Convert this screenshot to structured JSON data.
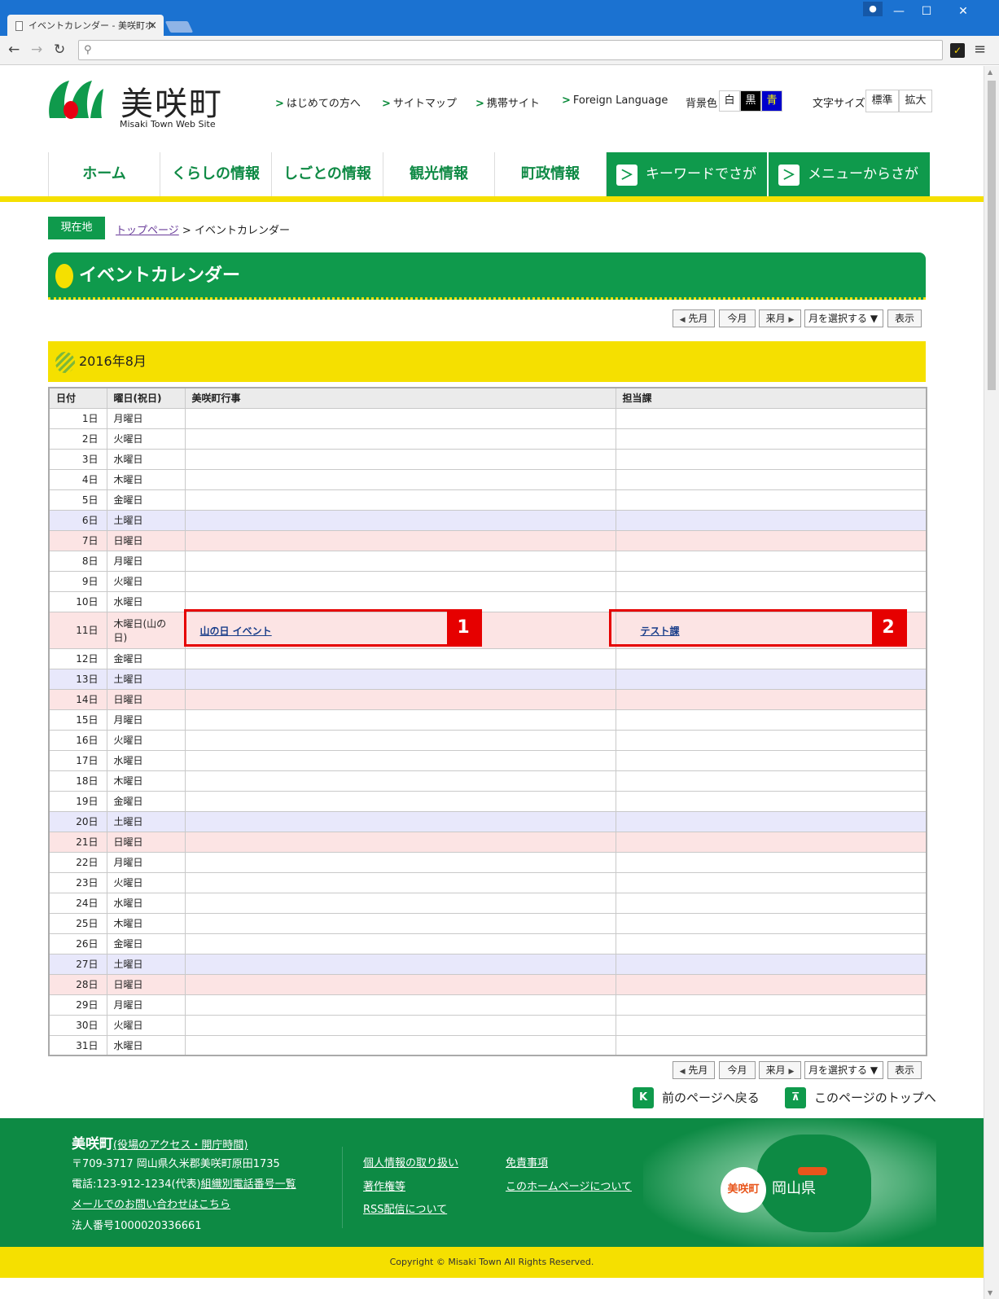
{
  "browser": {
    "tab_title": "イベントカレンダー - 美咲町ホ",
    "close": "×",
    "window_controls": {
      "min": "—",
      "max": "☐",
      "close": "✕"
    }
  },
  "header": {
    "site_name": "美咲町",
    "site_sub": "Misaki Town Web Site",
    "top_links": [
      "はじめての方へ",
      "サイトマップ",
      "携帯サイト",
      "Foreign Language"
    ],
    "bg_label": "背景色",
    "bg_options": [
      {
        "label": "白",
        "bg": "#ffffff",
        "fg": "#222222"
      },
      {
        "label": "黒",
        "bg": "#000000",
        "fg": "#ffffff"
      },
      {
        "label": "青",
        "bg": "#0000cc",
        "fg": "#ffff00"
      }
    ],
    "font_size_label": "文字サイズ",
    "font_size_options": [
      "標準",
      "拡大"
    ]
  },
  "global_nav": {
    "items": [
      "ホーム",
      "くらしの情報",
      "しごとの情報",
      "観光情報",
      "町政情報"
    ],
    "search_keyword": "キーワードでさがす",
    "search_menu": "メニューからさがす",
    "chevron": "＞"
  },
  "breadcrumb": {
    "here": "現在地",
    "top": "トップページ",
    "sep": ">",
    "current": "イベントカレンダー"
  },
  "page_title": "イベントカレンダー",
  "month_nav": {
    "prev": "先月",
    "now": "今月",
    "next": "来月",
    "select": "月を選択する",
    "show": "表示",
    "caret": "▼",
    "tri_left": "◀",
    "tri_right": "▶"
  },
  "month_heading": "2016年8月",
  "calendar": {
    "headers": [
      "日付",
      "曜日(祝日)",
      "美咲町行事",
      "担当課"
    ],
    "rows": [
      {
        "day": "1日",
        "weekday": "月曜日",
        "type": "weekday",
        "event": "",
        "dept": ""
      },
      {
        "day": "2日",
        "weekday": "火曜日",
        "type": "weekday",
        "event": "",
        "dept": ""
      },
      {
        "day": "3日",
        "weekday": "水曜日",
        "type": "weekday",
        "event": "",
        "dept": ""
      },
      {
        "day": "4日",
        "weekday": "木曜日",
        "type": "weekday",
        "event": "",
        "dept": ""
      },
      {
        "day": "5日",
        "weekday": "金曜日",
        "type": "weekday",
        "event": "",
        "dept": ""
      },
      {
        "day": "6日",
        "weekday": "土曜日",
        "type": "sat",
        "event": "",
        "dept": ""
      },
      {
        "day": "7日",
        "weekday": "日曜日",
        "type": "sun",
        "event": "",
        "dept": ""
      },
      {
        "day": "8日",
        "weekday": "月曜日",
        "type": "weekday",
        "event": "",
        "dept": ""
      },
      {
        "day": "9日",
        "weekday": "火曜日",
        "type": "weekday",
        "event": "",
        "dept": ""
      },
      {
        "day": "10日",
        "weekday": "水曜日",
        "type": "weekday",
        "event": "",
        "dept": ""
      },
      {
        "day": "11日",
        "weekday": "木曜日(山の日)",
        "type": "hol",
        "event": "山の日 イベント",
        "dept": "テスト課"
      },
      {
        "day": "12日",
        "weekday": "金曜日",
        "type": "weekday",
        "event": "",
        "dept": ""
      },
      {
        "day": "13日",
        "weekday": "土曜日",
        "type": "sat",
        "event": "",
        "dept": ""
      },
      {
        "day": "14日",
        "weekday": "日曜日",
        "type": "sun",
        "event": "",
        "dept": ""
      },
      {
        "day": "15日",
        "weekday": "月曜日",
        "type": "weekday",
        "event": "",
        "dept": ""
      },
      {
        "day": "16日",
        "weekday": "火曜日",
        "type": "weekday",
        "event": "",
        "dept": ""
      },
      {
        "day": "17日",
        "weekday": "水曜日",
        "type": "weekday",
        "event": "",
        "dept": ""
      },
      {
        "day": "18日",
        "weekday": "木曜日",
        "type": "weekday",
        "event": "",
        "dept": ""
      },
      {
        "day": "19日",
        "weekday": "金曜日",
        "type": "weekday",
        "event": "",
        "dept": ""
      },
      {
        "day": "20日",
        "weekday": "土曜日",
        "type": "sat",
        "event": "",
        "dept": ""
      },
      {
        "day": "21日",
        "weekday": "日曜日",
        "type": "sun",
        "event": "",
        "dept": ""
      },
      {
        "day": "22日",
        "weekday": "月曜日",
        "type": "weekday",
        "event": "",
        "dept": ""
      },
      {
        "day": "23日",
        "weekday": "火曜日",
        "type": "weekday",
        "event": "",
        "dept": ""
      },
      {
        "day": "24日",
        "weekday": "水曜日",
        "type": "weekday",
        "event": "",
        "dept": ""
      },
      {
        "day": "25日",
        "weekday": "木曜日",
        "type": "weekday",
        "event": "",
        "dept": ""
      },
      {
        "day": "26日",
        "weekday": "金曜日",
        "type": "weekday",
        "event": "",
        "dept": ""
      },
      {
        "day": "27日",
        "weekday": "土曜日",
        "type": "sat",
        "event": "",
        "dept": ""
      },
      {
        "day": "28日",
        "weekday": "日曜日",
        "type": "sun",
        "event": "",
        "dept": ""
      },
      {
        "day": "29日",
        "weekday": "月曜日",
        "type": "weekday",
        "event": "",
        "dept": ""
      },
      {
        "day": "30日",
        "weekday": "火曜日",
        "type": "weekday",
        "event": "",
        "dept": ""
      },
      {
        "day": "31日",
        "weekday": "水曜日",
        "type": "weekday",
        "event": "",
        "dept": ""
      }
    ]
  },
  "annotations": [
    "1",
    "2"
  ],
  "page_nav": {
    "back": "前のページへ戻る",
    "top": "このページのトップへ",
    "back_icon": "K",
    "top_icon": "⊼"
  },
  "footer": {
    "name": "美咲町",
    "access": "(役場のアクセス・開庁時間)",
    "address": "〒709-3717 岡山県久米郡美咲町原田1735",
    "phone_prefix": "電話:123-912-1234(代表)",
    "phone_link": "組織別電話番号一覧",
    "mail": "メールでのお問い合わせはこちら",
    "corp": "法人番号1000020336661",
    "links": [
      "個人情報の取り扱い",
      "免責事項",
      "著作権等",
      "このホームページについて",
      "RSS配信について"
    ],
    "map_town": "美咲町",
    "map_pref": "岡山県"
  },
  "copyright": "Copyright © Misaki Town All Rights Reserved.",
  "colors": {
    "green": "#0f9a4c",
    "yellow": "#f5e000",
    "sat": "#e8e8fb",
    "sun": "#fce4e4",
    "highlight": "#e60000"
  }
}
